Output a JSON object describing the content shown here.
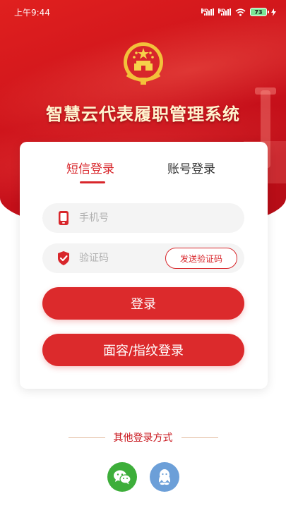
{
  "status_bar": {
    "time": "上午9:44",
    "signal1_label": "HD",
    "signal2_label": "HD",
    "battery": "73"
  },
  "app": {
    "title": "智慧云代表履职管理系统",
    "primary_color": "#dc2a2c"
  },
  "login": {
    "tabs": [
      {
        "label": "短信登录",
        "active": true
      },
      {
        "label": "账号登录",
        "active": false
      }
    ],
    "phone_placeholder": "手机号",
    "code_placeholder": "验证码",
    "send_code_label": "发送验证码",
    "login_label": "登录",
    "face_login_label": "面容/指纹登录"
  },
  "other_login": {
    "title": "其他登录方式",
    "methods": [
      {
        "icon": "wechat-icon",
        "color": "#3dae3a"
      },
      {
        "icon": "qq-icon",
        "color": "#6c9fd8"
      }
    ]
  }
}
